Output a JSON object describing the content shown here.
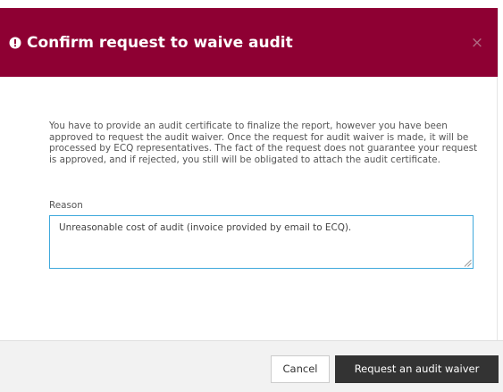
{
  "dialog": {
    "title": "Confirm request to waive audit",
    "close_symbol": "×",
    "message": "You have to provide an audit certificate to finalize the report, however you have been approved to request the audit waiver. Once the request for audit waiver is made, it will be processed by ECQ representatives. The fact of the request does not guarantee your request is approved, and if rejected, you still will be obligated to attach the audit certificate.",
    "reason_label": "Reason",
    "reason_value": "Unreasonable cost of audit (invoice provided by email to ECQ)."
  },
  "buttons": {
    "cancel": "Cancel",
    "submit": "Request an audit waiver"
  },
  "icons": {
    "header": "exclamation-circle-icon",
    "close": "close-icon",
    "resize": "resize-grip-icon"
  },
  "colors": {
    "header_bg": "#8e0033",
    "header_text": "#ffffff",
    "field_border": "#3fa9dc",
    "primary_button_bg": "#333333",
    "footer_bg": "#f2f2f2"
  }
}
